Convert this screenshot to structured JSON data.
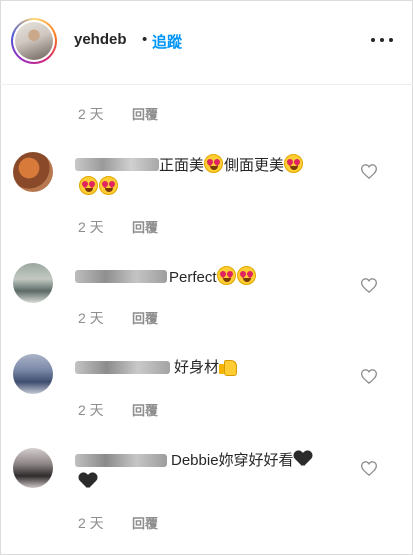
{
  "header": {
    "username": "yehdeb",
    "separator": "•",
    "follow_label": "追蹤"
  },
  "caption_meta": {
    "time": "2 天",
    "reply_label": "回覆"
  },
  "comments": [
    {
      "text": "正面美",
      "text2": "側面更美",
      "time": "2 天",
      "reply_label": "回覆"
    },
    {
      "text": "Perfect",
      "time": "2 天",
      "reply_label": "回覆"
    },
    {
      "text": "好身材",
      "time": "2 天",
      "reply_label": "回覆"
    },
    {
      "text": "Debbie妳穿好好看",
      "time": "2 天",
      "reply_label": "回覆"
    }
  ],
  "icons": {
    "more": "more-horizontal-icon",
    "like": "heart-outline-icon",
    "emoji_love": "heart-eyes-emoji",
    "emoji_thumb": "thumbs-up-emoji",
    "emoji_black_heart": "black-heart-emoji"
  },
  "colors": {
    "accent": "#0095f6",
    "muted": "#8e8e8e",
    "text": "#262626"
  }
}
